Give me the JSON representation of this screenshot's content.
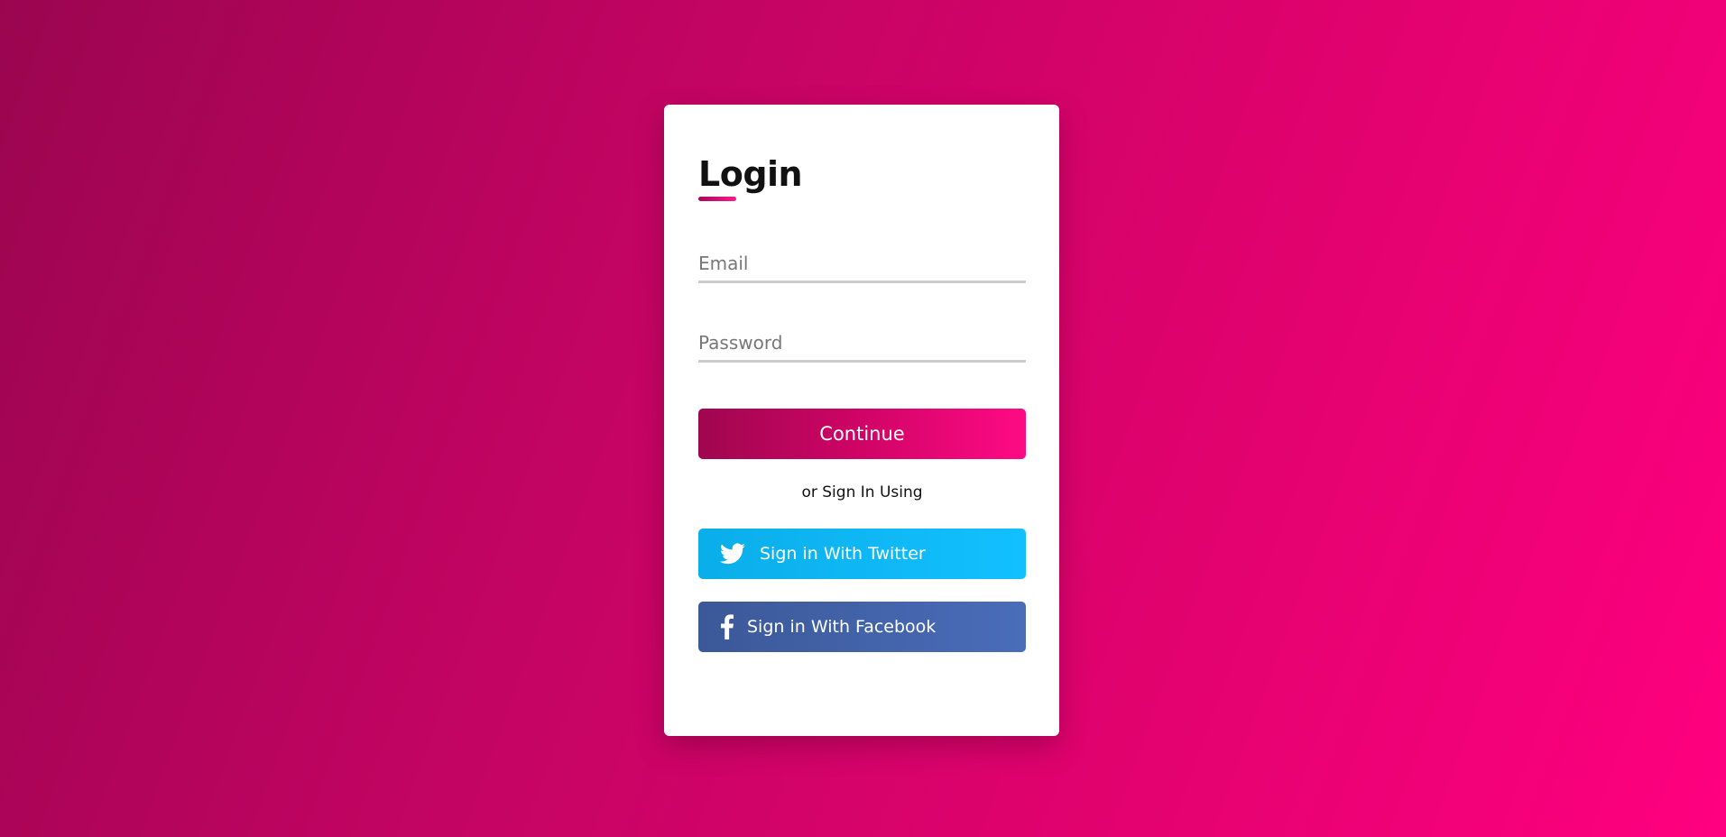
{
  "login": {
    "title": "Login",
    "email_placeholder": "Email",
    "password_placeholder": "Password",
    "continue_label": "Continue",
    "or_text": "or Sign In Using",
    "twitter_label": "Sign in With Twitter",
    "facebook_label": "Sign in With Facebook"
  },
  "colors": {
    "background_start": "#9b0550",
    "background_end": "#ff0080",
    "twitter": "#13c0ff",
    "facebook": "#4267b2",
    "card": "#ffffff"
  },
  "icons": {
    "twitter": "twitter-icon",
    "facebook": "facebook-icon"
  }
}
